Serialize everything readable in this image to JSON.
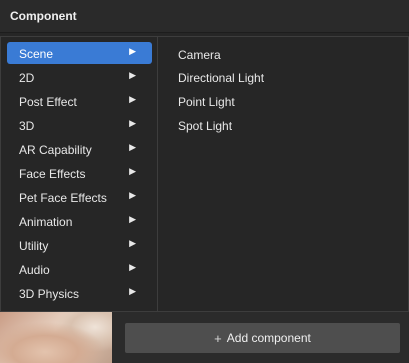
{
  "panel": {
    "title": "Component"
  },
  "menu": {
    "items": [
      {
        "label": "Scene",
        "active": true
      },
      {
        "label": "2D"
      },
      {
        "label": "Post Effect"
      },
      {
        "label": "3D"
      },
      {
        "label": "AR Capability"
      },
      {
        "label": "Face Effects"
      },
      {
        "label": "Pet Face Effects"
      },
      {
        "label": "Animation"
      },
      {
        "label": "Utility"
      },
      {
        "label": "Audio"
      },
      {
        "label": "3D Physics"
      }
    ],
    "caret_glyph": "▶",
    "active_color": "#3a7bd5"
  },
  "submenu": {
    "items": [
      {
        "label": "Camera"
      },
      {
        "label": "Directional Light"
      },
      {
        "label": "Point Light"
      },
      {
        "label": "Spot Light"
      }
    ]
  },
  "footer": {
    "add_icon": "+",
    "add_label": "Add component"
  }
}
